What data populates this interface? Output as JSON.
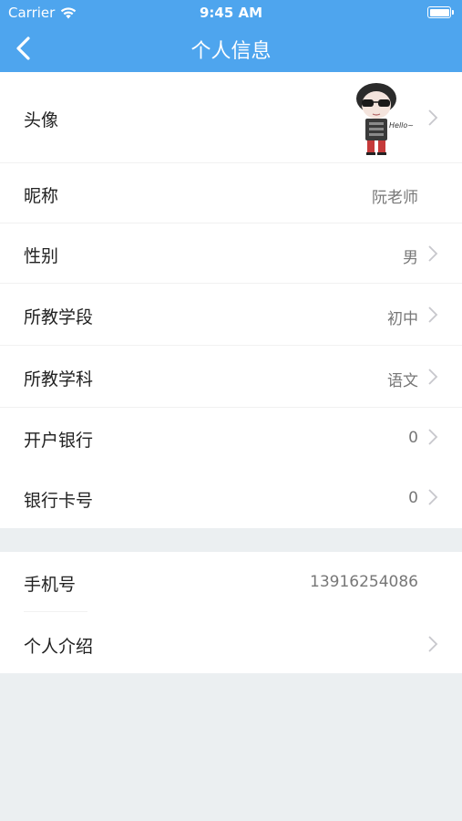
{
  "status_bar": {
    "carrier": "Carrier",
    "time": "9:45 AM"
  },
  "navbar": {
    "title": "个人信息"
  },
  "avatar_caption": "Hello~",
  "section1": [
    {
      "label": "头像",
      "value": "",
      "has_avatar": true,
      "has_chevron": true
    },
    {
      "label": "昵称",
      "value": "阮老师",
      "has_chevron": false
    },
    {
      "label": "性别",
      "value": "男",
      "has_chevron": true
    },
    {
      "label": "所教学段",
      "value": "初中",
      "has_chevron": true
    },
    {
      "label": "所教学科",
      "value": "语文",
      "has_chevron": true
    },
    {
      "label": "开户银行",
      "value": "0",
      "has_chevron": true
    },
    {
      "label": "银行卡号",
      "value": "0",
      "has_chevron": true
    }
  ],
  "section2": [
    {
      "label": "手机号",
      "value": "13916254086",
      "has_chevron": false
    },
    {
      "label": "个人介绍",
      "value": "",
      "has_chevron": true
    }
  ],
  "colors": {
    "navbar": "#4ea5ee",
    "background": "#ebeff1"
  }
}
